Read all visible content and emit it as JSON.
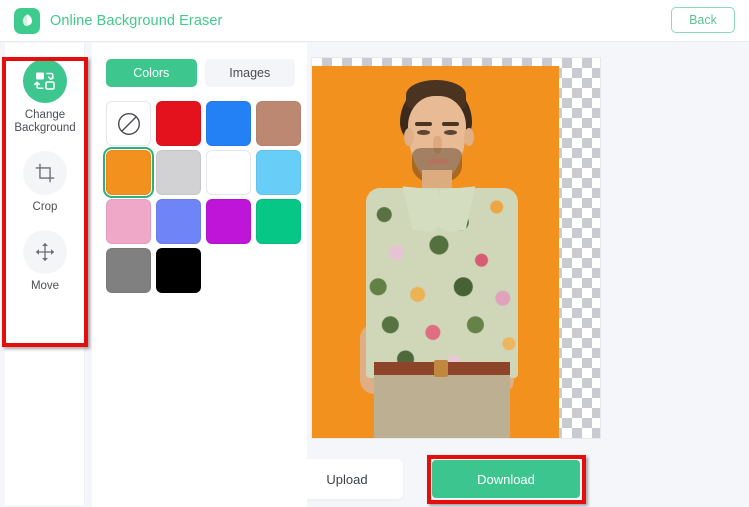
{
  "header": {
    "title": "Online Background Eraser",
    "logo_icon": "leaf-logo-icon",
    "back_label": "Back",
    "brand_color": "#43c88c"
  },
  "sidebar": {
    "items": [
      {
        "label": "Change Background",
        "icon": "swap-background-icon",
        "active": true
      },
      {
        "label": "Crop",
        "icon": "crop-icon",
        "active": false
      },
      {
        "label": "Move",
        "icon": "move-arrows-icon",
        "active": false
      }
    ]
  },
  "panel": {
    "tabs": [
      {
        "label": "Colors",
        "active": true
      },
      {
        "label": "Images",
        "active": false
      }
    ],
    "swatches": [
      {
        "name": "none",
        "color": "transparent",
        "selected": false
      },
      {
        "name": "red",
        "color": "#e3121d",
        "selected": false
      },
      {
        "name": "blue",
        "color": "#2481f5",
        "selected": false
      },
      {
        "name": "tan",
        "color": "#bd8872",
        "selected": false
      },
      {
        "name": "orange",
        "color": "#f2911d",
        "selected": true
      },
      {
        "name": "light-gray",
        "color": "#d2d2d4",
        "selected": false
      },
      {
        "name": "white",
        "color": "#ffffff",
        "selected": false
      },
      {
        "name": "sky-blue",
        "color": "#68cdf7",
        "selected": false
      },
      {
        "name": "pink",
        "color": "#efa8c8",
        "selected": false
      },
      {
        "name": "periwinkle",
        "color": "#6f85f7",
        "selected": false
      },
      {
        "name": "magenta",
        "color": "#bf15d8",
        "selected": false
      },
      {
        "name": "green",
        "color": "#06c785",
        "selected": false
      },
      {
        "name": "gray",
        "color": "#808080",
        "selected": false
      },
      {
        "name": "black",
        "color": "#000000",
        "selected": false
      }
    ]
  },
  "canvas": {
    "background_color": "#f2911d",
    "transparent_checker": true
  },
  "actions": {
    "upload_label": "Upload",
    "download_label": "Download",
    "download_color": "#3dc58f"
  },
  "annotations": {
    "highlight_color": "#e60d0d",
    "regions": [
      "sidebar-tools",
      "download-button"
    ]
  }
}
